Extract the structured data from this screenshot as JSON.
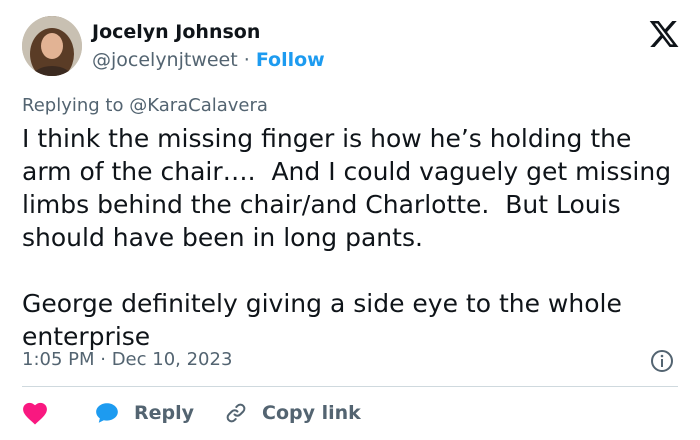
{
  "author": {
    "name": "Jocelyn Johnson",
    "handle": "@jocelynjtweet",
    "separator": "·",
    "follow_label": "Follow"
  },
  "reply_context": {
    "text": "Replying to @KaraCalavera"
  },
  "tweet": {
    "text": "I think the missing finger is how he’s holding the arm of the chair….  And I could vaguely get missing limbs behind the chair/and Charlotte.  But Louis should have been in long pants.\n\nGeorge definitely giving a side eye to the whole enterprise"
  },
  "meta": {
    "time": "1:05 PM · Dec 10, 2023"
  },
  "actions": {
    "reply_label": "Reply",
    "copy_link_label": "Copy link"
  },
  "icons": {
    "logo": "x-logo-icon",
    "info": "info-icon",
    "heart": "heart-icon",
    "reply": "speech-bubble-icon",
    "link": "link-icon"
  },
  "colors": {
    "accent": "#1d9bf0",
    "heart": "#f91880",
    "secondary_text": "#536471",
    "primary_text": "#0f1419",
    "divider": "#cfd9de"
  }
}
